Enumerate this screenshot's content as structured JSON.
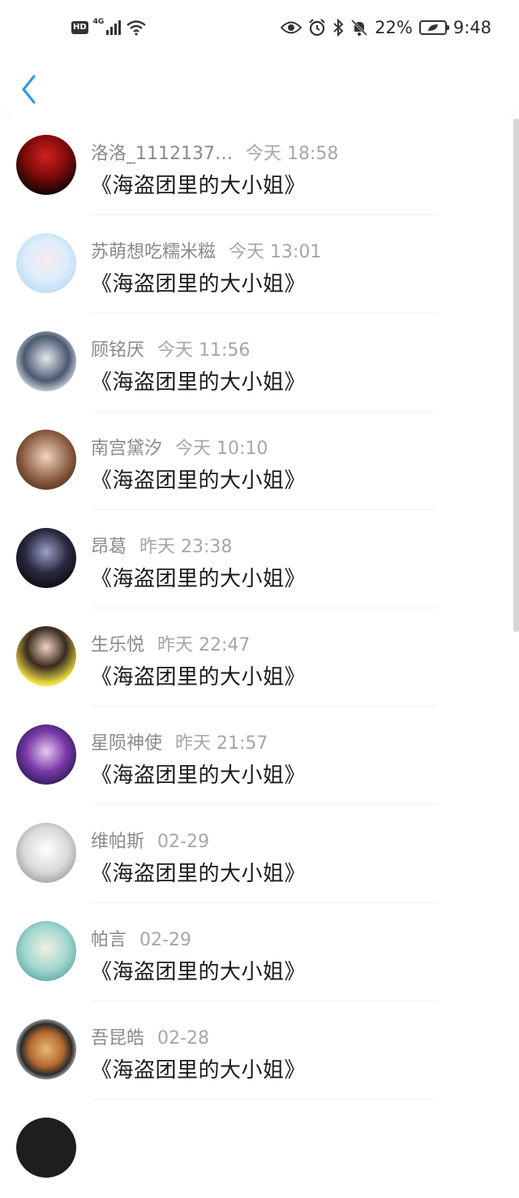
{
  "status_bar": {
    "hd": "HD",
    "network": "4G",
    "battery": "22%",
    "time": "9:48",
    "icons": [
      "eye-icon",
      "alarm-icon",
      "bluetooth-icon",
      "bell-off-icon",
      "battery-leaf-icon"
    ]
  },
  "nav": {
    "back_icon": "chevron-left-icon",
    "accent": "#2d9cdb"
  },
  "items": [
    {
      "name": "洛洛_1112137…",
      "time": "今天 18:58",
      "message": "《海盗团里的大小姐》"
    },
    {
      "name": "苏萌想吃糯米糍",
      "time": "今天 13:01",
      "message": "《海盗团里的大小姐》"
    },
    {
      "name": "顾铭厌",
      "time": "今天 11:56",
      "message": "《海盗团里的大小姐》"
    },
    {
      "name": "南宫黛汐",
      "time": "今天 10:10",
      "message": "《海盗团里的大小姐》"
    },
    {
      "name": "昂葛",
      "time": "昨天 23:38",
      "message": "《海盗团里的大小姐》"
    },
    {
      "name": "生乐悦",
      "time": "昨天 22:47",
      "message": "《海盗团里的大小姐》"
    },
    {
      "name": "星陨神使",
      "time": "昨天 21:57",
      "message": "《海盗团里的大小姐》"
    },
    {
      "name": "维帕斯",
      "time": "02-29",
      "message": "《海盗团里的大小姐》"
    },
    {
      "name": "帕言",
      "time": "02-29",
      "message": "《海盗团里的大小姐》"
    },
    {
      "name": "吾昆皓",
      "time": "02-28",
      "message": "《海盗团里的大小姐》"
    }
  ]
}
